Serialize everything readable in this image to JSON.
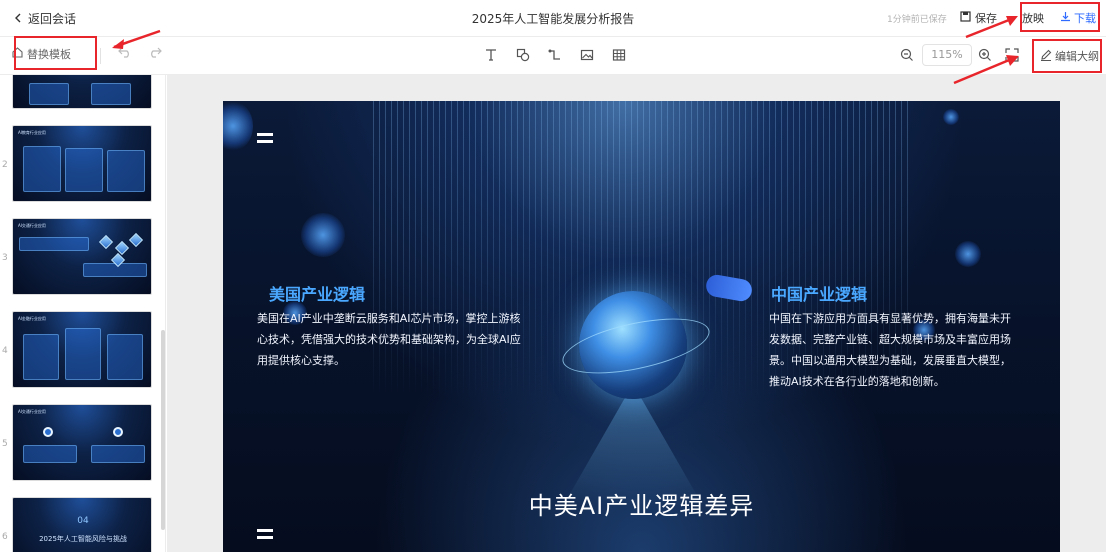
{
  "topbar": {
    "back_label": "返回会话",
    "title": "2025年人工智能发展分析报告",
    "save_status": "1分钟前已保存",
    "save_label": "保存",
    "present_label": "放映",
    "download_label": "下载"
  },
  "toolbar": {
    "template_label": "替换模板",
    "zoom": "115%",
    "outline_label": "编辑大纲",
    "tools": [
      "text-icon",
      "shape-icon",
      "connector-icon",
      "image-icon",
      "table-icon"
    ]
  },
  "sidebar": {
    "thumbnails": [
      {
        "num": "",
        "title": ""
      },
      {
        "num": "2",
        "title": "AI教育行业应用"
      },
      {
        "num": "3",
        "title": "AI交通行业应用"
      },
      {
        "num": "4",
        "title": "AI金融行业应用"
      },
      {
        "num": "5",
        "title": "AI交通行业应用"
      },
      {
        "num": "6",
        "title": "2025年人工智能风险与挑战",
        "section": "04"
      }
    ]
  },
  "slide": {
    "left_heading": "美国产业逻辑",
    "left_body": "美国在AI产业中垄断云服务和AI芯片市场，掌控上游核心技术，凭借强大的技术优势和基础架构，为全球AI应用提供核心支撑。",
    "right_heading": "中国产业逻辑",
    "right_body": "中国在下游应用方面具有显著优势，拥有海量未开发数据、完整产业链、超大规模市场及丰富应用场景。中国以通用大模型为基础，发展垂直大模型，推动AI技术在各行业的落地和创新。",
    "title": "中美AI产业逻辑差异"
  },
  "colors": {
    "accent_blue": "#2f6bff",
    "heading_blue": "#4aa8ff",
    "annotation_red": "#e8252b"
  }
}
